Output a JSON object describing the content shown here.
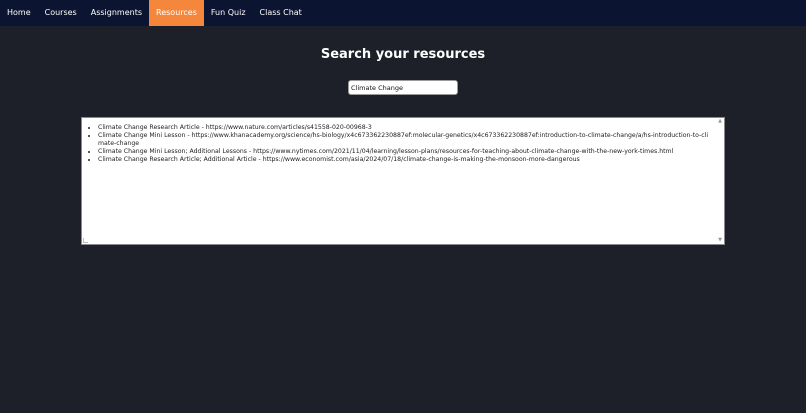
{
  "nav": {
    "items": [
      {
        "label": "Home"
      },
      {
        "label": "Courses"
      },
      {
        "label": "Assignments"
      },
      {
        "label": "Resources",
        "active": true
      },
      {
        "label": "Fun Quiz"
      },
      {
        "label": "Class Chat"
      }
    ]
  },
  "main": {
    "title": "Search your resources",
    "search": {
      "value": "Climate Change"
    },
    "results": [
      "Climate Change Research Article - https://www.nature.com/articles/s41558-020-00968-3",
      "Climate Change Mini Lesson - https://www.khanacademy.org/science/hs-biology/x4c673362230887ef:molecular-genetics/x4c673362230887ef:introduction-to-climate-change/a/hs-introduction-to-climate-change",
      "Climate Change Mini Lesson; Additional Lessons - https://www.nytimes.com/2021/11/04/learning/lesson-plans/resources-for-teaching-about-climate-change-with-the-new-york-times.html",
      "Climate Change Research Article; Additional Article - https://www.economist.com/asia/2024/07/18/climate-change-is-making-the-monsoon-more-dangerous"
    ]
  },
  "colors": {
    "background": "#1d2029",
    "navbar": "#0b1531",
    "active_tab": "#f4873c"
  }
}
